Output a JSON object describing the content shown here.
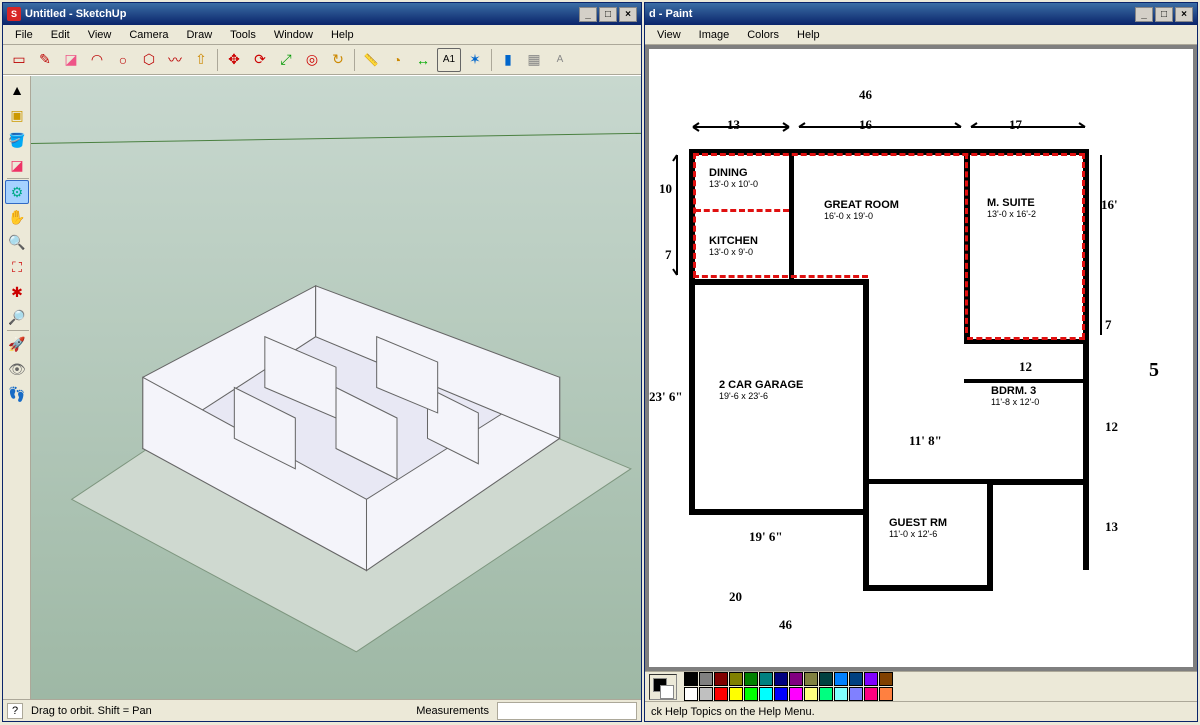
{
  "sketchup": {
    "title": "Untitled - SketchUp",
    "menus": [
      "File",
      "Edit",
      "View",
      "Camera",
      "Draw",
      "Tools",
      "Window",
      "Help"
    ],
    "status_hint": "Drag to orbit.  Shift = Pan",
    "measurements_label": "Measurements",
    "measurements_value": "",
    "toolbar_icons": [
      "rectangle",
      "line",
      "eraser",
      "arc",
      "circle",
      "polygon",
      "freehand",
      "pushpull",
      "sep",
      "move",
      "rotate",
      "scale",
      "offset",
      "sep",
      "tape",
      "protractor",
      "dimension",
      "text",
      "axes",
      "sep",
      "paint",
      "walk",
      "look",
      "section",
      "sep",
      "3dtext"
    ],
    "side_icons": [
      "select",
      "component",
      "paint-bucket",
      "eraser-tool",
      "sep",
      "orbit",
      "pan",
      "zoom",
      "zoom-extents",
      "zoom-window",
      "previous",
      "sep",
      "position-camera",
      "look-around",
      "walk-tool"
    ]
  },
  "paint": {
    "title_suffix": "d - Paint",
    "menus": [
      "View",
      "Image",
      "Colors",
      "Help"
    ],
    "status_text": "ck Help Topics on the Help Menu.",
    "palette": [
      "#000000",
      "#808080",
      "#800000",
      "#808000",
      "#008000",
      "#008080",
      "#000080",
      "#800080",
      "#808040",
      "#004040",
      "#0080ff",
      "#004080",
      "#8000ff",
      "#804000",
      "#ffffff",
      "#c0c0c0",
      "#ff0000",
      "#ffff00",
      "#00ff00",
      "#00ffff",
      "#0000ff",
      "#ff00ff",
      "#ffff80",
      "#00ff80",
      "#80ffff",
      "#8080ff",
      "#ff0080",
      "#ff8040"
    ]
  },
  "floorplan": {
    "rooms": {
      "dining": {
        "label": "DINING",
        "dims": "13'-0 x 10'-0"
      },
      "great_room": {
        "label": "GREAT ROOM",
        "dims": "16'-0 x 19'-0"
      },
      "m_suite": {
        "label": "M. SUITE",
        "dims": "13'-0 x 16'-2"
      },
      "kitchen": {
        "label": "KITCHEN",
        "dims": "13'-0 x 9'-0"
      },
      "garage": {
        "label": "2 CAR GARAGE",
        "dims": "19'-6 x 23'-6"
      },
      "bdrm3": {
        "label": "BDRM. 3",
        "dims": "11'-8 x 12'-0"
      },
      "guest": {
        "label": "GUEST RM",
        "dims": "11'-0 x 12'-6"
      }
    },
    "hand_dims": {
      "top_13": "13",
      "top_16": "16",
      "top_17": "17",
      "top_46": "46",
      "left_10": "10",
      "left_7l": "7",
      "left_23_6": "23' 6\"",
      "left_19_6": "19' 6\"",
      "right_16": "16'",
      "right_7": "7",
      "right_5": "5",
      "right_12": "12",
      "right_13": "13",
      "bdrm3_top": "12",
      "inner_11_8": "11' 8\"",
      "bottom_46": "46",
      "bottom_20": "20"
    }
  }
}
